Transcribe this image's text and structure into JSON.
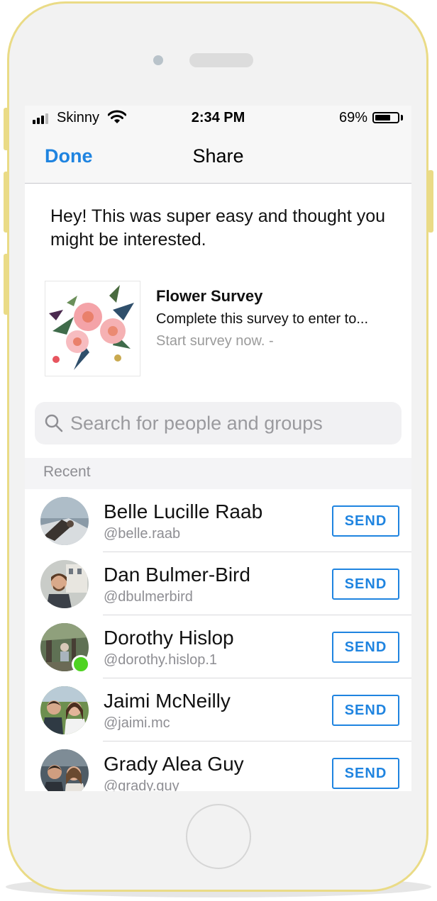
{
  "status_bar": {
    "carrier": "Skinny",
    "time": "2:34 PM",
    "battery_percent": "69%",
    "battery_level": 0.69
  },
  "nav": {
    "done_label": "Done",
    "title": "Share"
  },
  "message": "Hey! This was super easy and thought you might be interested.",
  "share_card": {
    "title": "Flower Survey",
    "description": "Complete this survey to enter to...",
    "link_text": "Start survey now. -"
  },
  "search": {
    "placeholder": "Search for people and groups",
    "value": ""
  },
  "section_label": "Recent",
  "contacts": [
    {
      "name": "Belle Lucille Raab",
      "handle": "@belle.raab",
      "send_label": "SEND",
      "online": false
    },
    {
      "name": "Dan Bulmer-Bird",
      "handle": "@dbulmerbird",
      "send_label": "SEND",
      "online": false
    },
    {
      "name": "Dorothy Hislop",
      "handle": "@dorothy.hislop.1",
      "send_label": "SEND",
      "online": true
    },
    {
      "name": "Jaimi McNeilly",
      "handle": "@jaimi.mc",
      "send_label": "SEND",
      "online": false
    },
    {
      "name": "Grady Alea Guy",
      "handle": "@grady.guy",
      "send_label": "SEND",
      "online": false
    }
  ],
  "colors": {
    "accent": "#1f84e0",
    "frame": "#eadb86",
    "online": "#4ed321"
  },
  "icons": {
    "signal": "signal-bars-icon",
    "wifi": "wifi-icon",
    "battery": "battery-icon",
    "search": "search-icon"
  }
}
